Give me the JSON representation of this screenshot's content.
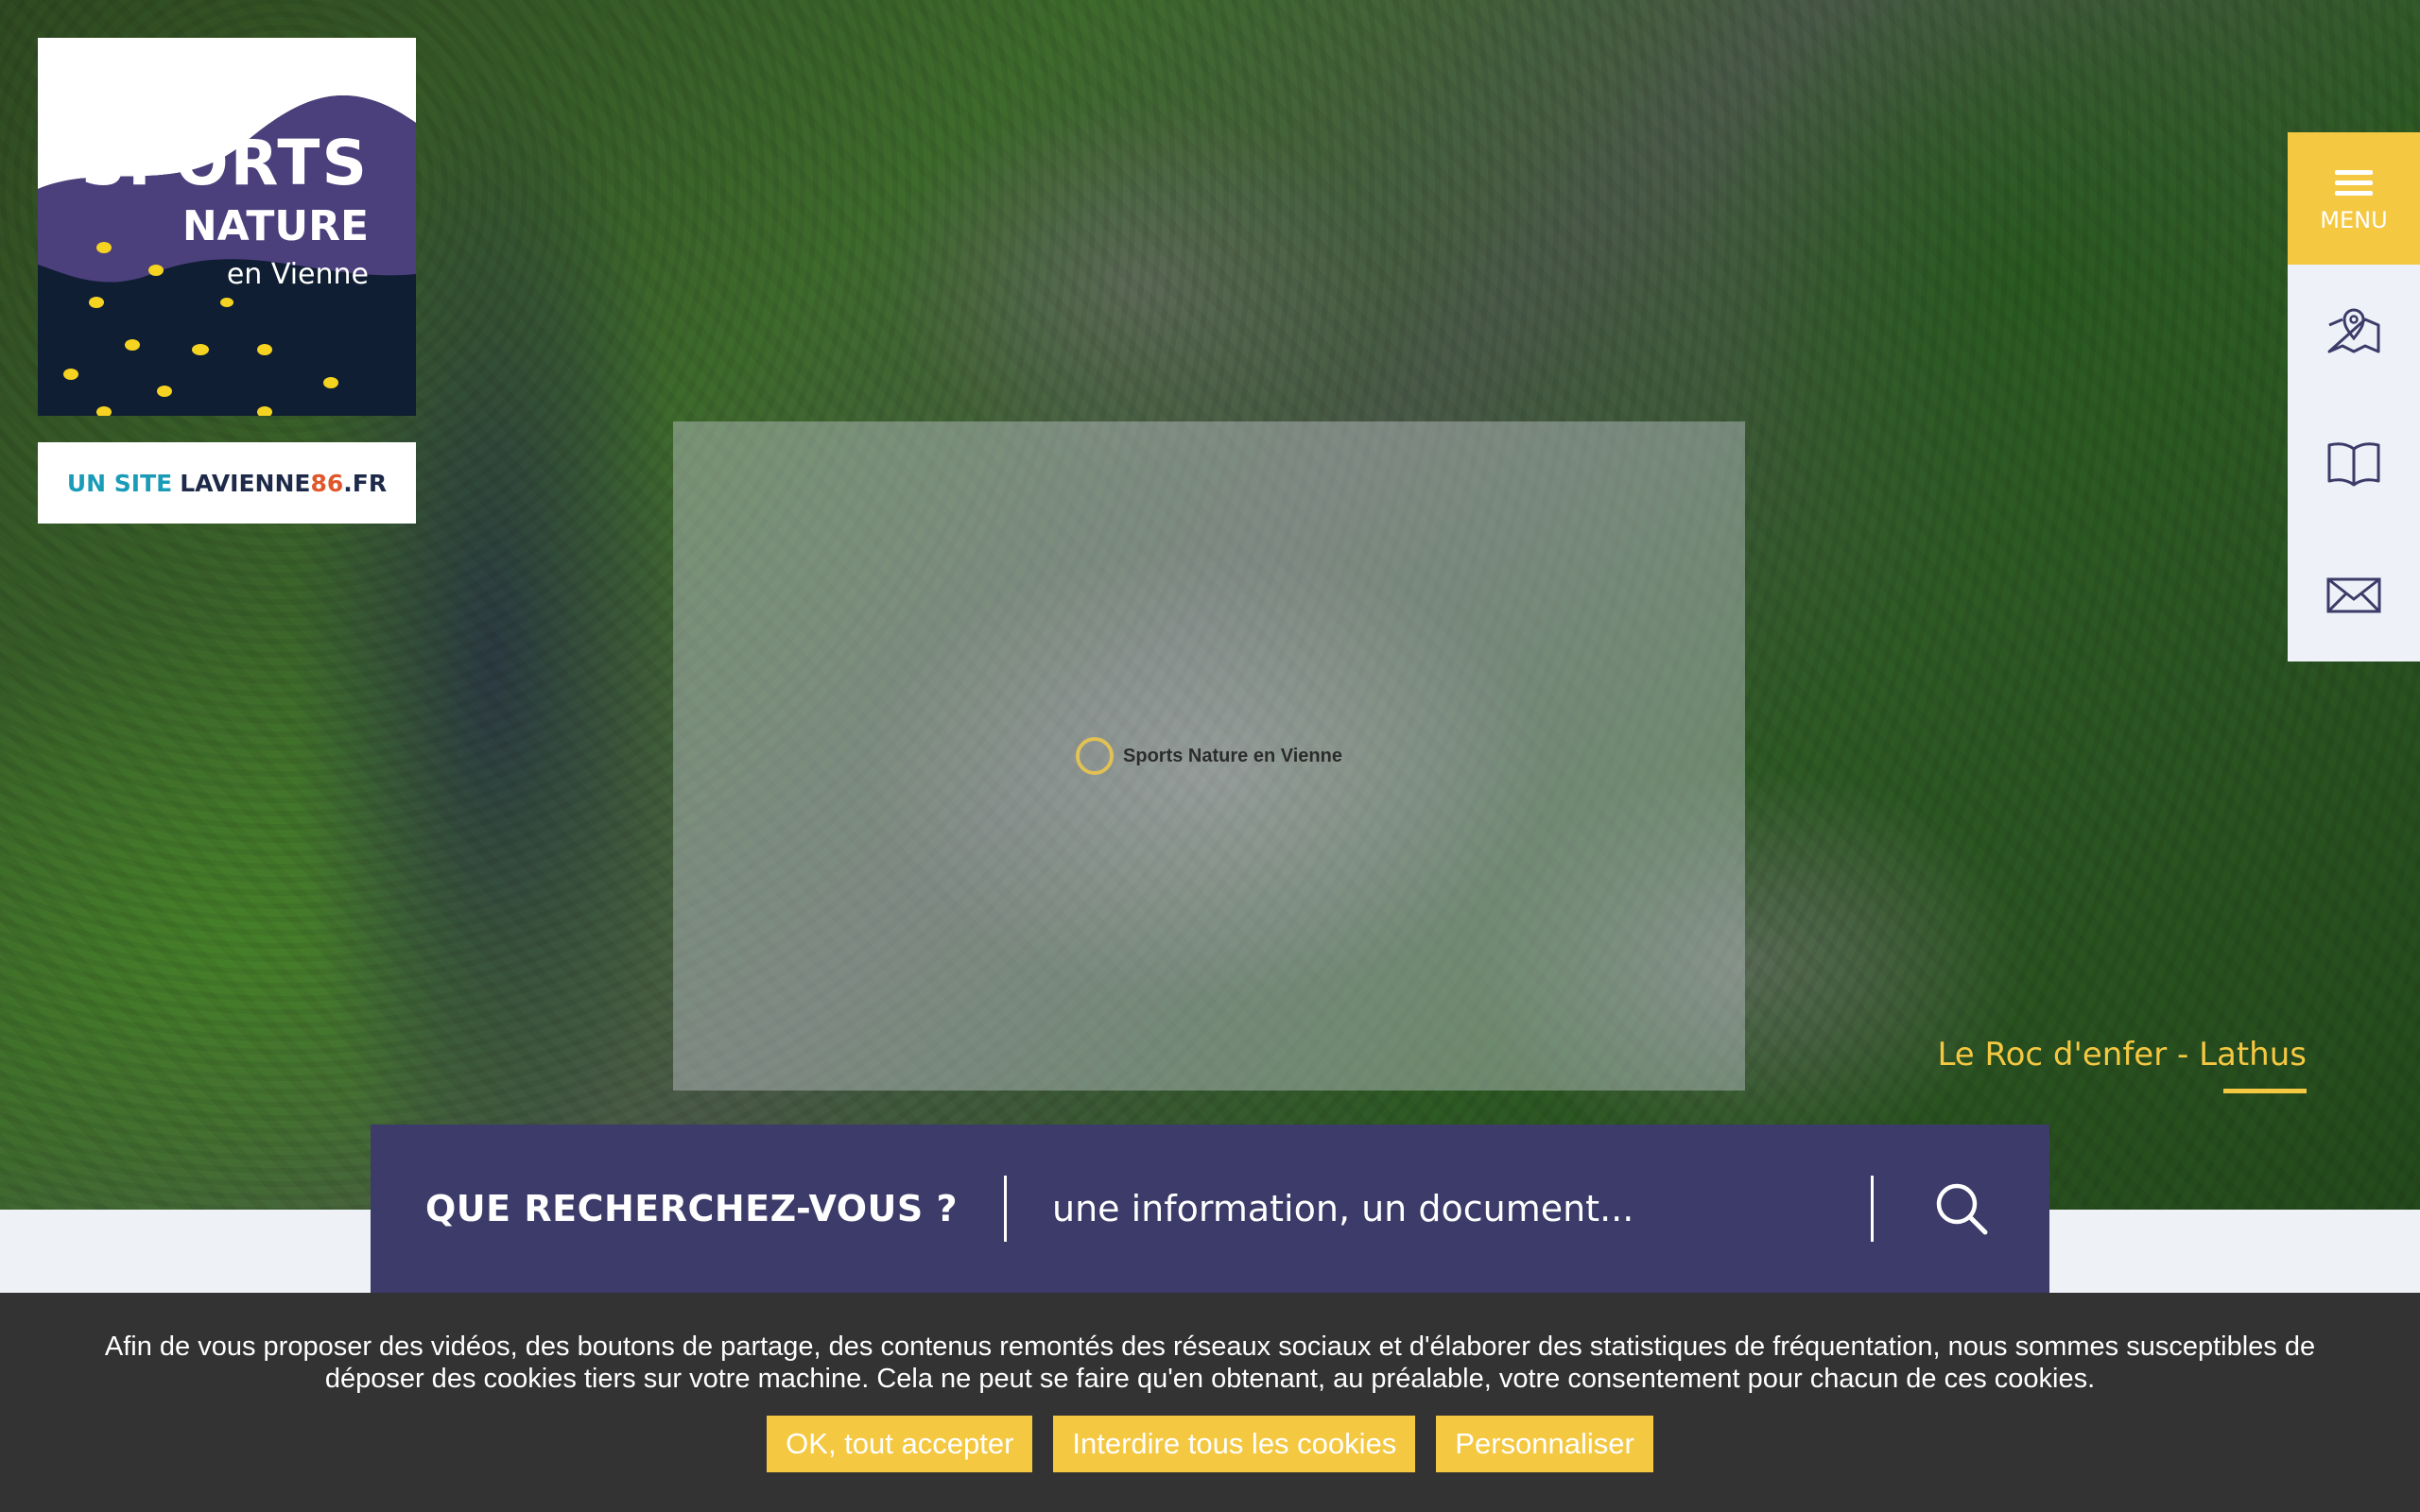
{
  "logo": {
    "line1": "SPORTS",
    "line2": "NATURE",
    "line3": "en Vienne"
  },
  "site_tag": {
    "prefix": "UN SITE",
    "domain_main": "LAVIENNE",
    "domain_num": "86",
    "domain_ext": ".FR"
  },
  "video": {
    "brand_name": "Sports Nature en Vienne"
  },
  "caption": "Le Roc d'enfer - Lathus",
  "side_menu": {
    "menu_label": "MENU",
    "icons": [
      "map-pin-icon",
      "book-icon",
      "mail-icon"
    ]
  },
  "search": {
    "label": "QUE RECHERCHEZ-VOUS ?",
    "placeholder": "une information, un document..."
  },
  "cookie": {
    "text": "Afin de vous proposer des vidéos, des boutons de partage, des contenus remontés des réseaux sociaux et d'élaborer des statistiques de fréquentation, nous sommes susceptibles de déposer des cookies tiers sur votre machine. Cela ne peut se faire qu'en obtenant, au préalable, votre consentement pour chacun de ces cookies.",
    "accept": "OK, tout accepter",
    "deny": "Interdire tous les cookies",
    "customize": "Personnaliser"
  },
  "colors": {
    "accent_yellow": "#f5c842",
    "search_bg": "#3c3b69",
    "cookie_bg": "#333333",
    "logo_bg": "#0f1e33"
  }
}
